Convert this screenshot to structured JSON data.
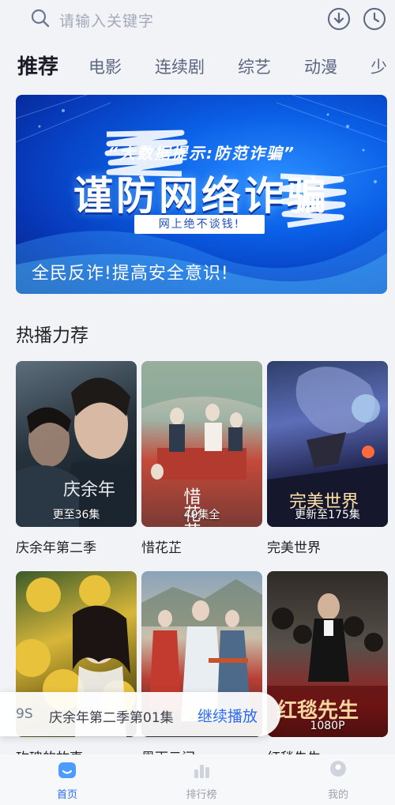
{
  "search": {
    "placeholder": "请输入关键字"
  },
  "header_icons": [
    "search-icon",
    "download-icon",
    "history-clock-icon"
  ],
  "tabs": [
    {
      "label": "推荐",
      "active": true
    },
    {
      "label": "电影"
    },
    {
      "label": "连续剧"
    },
    {
      "label": "综艺"
    },
    {
      "label": "动漫"
    },
    {
      "label": "少"
    }
  ],
  "banner": {
    "subtitle": "“大数据提示:防范诈骗”",
    "title": "谨防网络诈骗",
    "slogan": "网上绝不谈钱!",
    "caption": "全民反诈!提高安全意识!"
  },
  "section": {
    "title": "热播力荐"
  },
  "cards": [
    {
      "title": "庆余年第二季",
      "badge": "更至36集",
      "poster_text": "庆余年"
    },
    {
      "title": "惜花芷",
      "badge": "40集全",
      "poster_text": "惜花芷"
    },
    {
      "title": "完美世界",
      "badge": "更新至175集",
      "poster_text": "完美世界"
    },
    {
      "title": "玫瑰的故事",
      "badge": "",
      "poster_text": ""
    },
    {
      "title": "墨雨云间",
      "badge": "",
      "poster_text": ""
    },
    {
      "title": "红毯先生",
      "badge": "1080P",
      "poster_text": "红毯先生"
    }
  ],
  "continue": {
    "episode": "9S",
    "text": "庆余年第二季第01集",
    "button": "继续播放"
  },
  "bottom_nav": [
    {
      "label": "首页",
      "icon": "home-icon",
      "active": true
    },
    {
      "label": "排行榜",
      "icon": "ranking-icon"
    },
    {
      "label": "我的",
      "icon": "profile-icon"
    }
  ],
  "colors": {
    "accent": "#2a6cf5",
    "tab_inactive": "#5b6682",
    "background": "#f2f3f7"
  }
}
